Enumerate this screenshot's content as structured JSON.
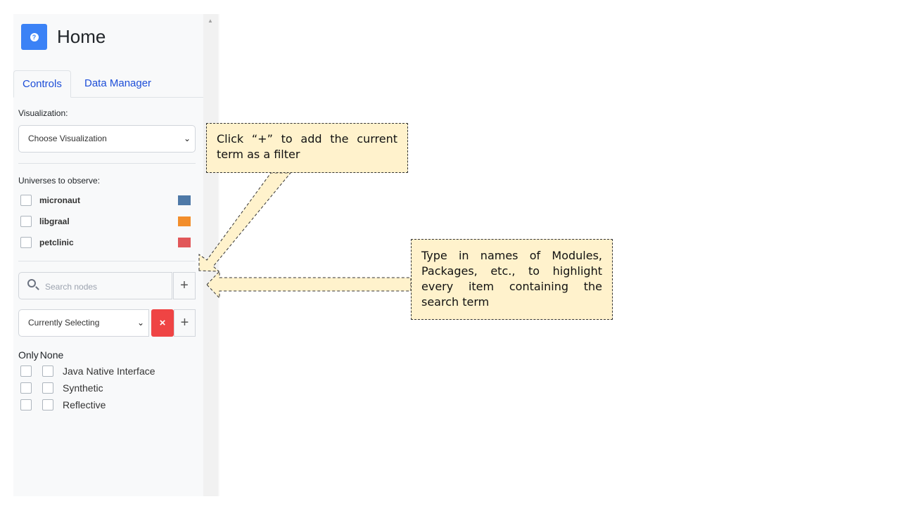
{
  "header": {
    "title": "Home",
    "help_icon": "question-circle-icon",
    "help_color": "#3b82f6"
  },
  "tabs": [
    {
      "label": "Controls",
      "active": true
    },
    {
      "label": "Data Manager",
      "active": false
    }
  ],
  "visualization": {
    "label": "Visualization:",
    "selected": "Choose Visualization"
  },
  "universes": {
    "label": "Universes to observe:",
    "items": [
      {
        "name": "micronaut",
        "checked": false,
        "color": "#4e79a7"
      },
      {
        "name": "libgraal",
        "checked": false,
        "color": "#f28e2b"
      },
      {
        "name": "petclinic",
        "checked": false,
        "color": "#e15759"
      }
    ]
  },
  "search": {
    "placeholder": "Search nodes",
    "value": "",
    "add_label": "+"
  },
  "selection": {
    "selected": "Currently Selecting",
    "clear_label": "×",
    "add_label": "+"
  },
  "filters": {
    "headers": [
      "Only",
      "None"
    ],
    "items": [
      {
        "name": "Java Native Interface"
      },
      {
        "name": "Synthetic"
      },
      {
        "name": "Reflective"
      }
    ]
  },
  "tooltips": {
    "plus_hint": "Click “+” to add the current term as a filter",
    "search_hint": "Type in names of Modules, Packages, etc., to highlight every item containing the search term"
  },
  "colors": {
    "accent": "#3b82f6",
    "danger": "#ef4444",
    "tooltip_bg": "#fff2cc"
  }
}
